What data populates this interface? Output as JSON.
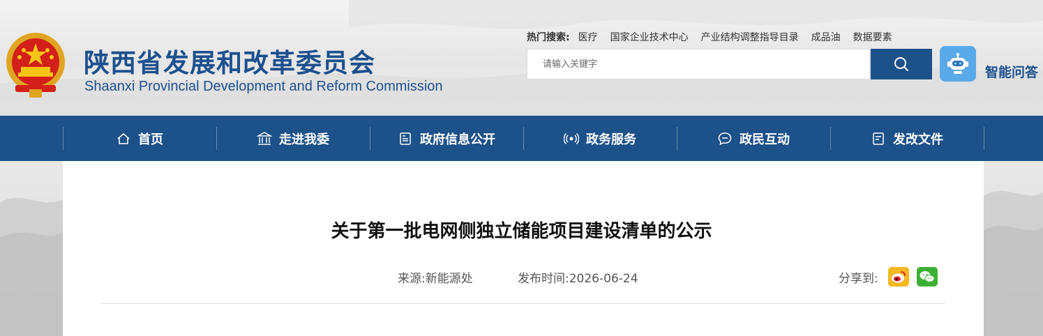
{
  "header": {
    "title_cn": "陕西省发展和改革委员会",
    "title_en": "Shaanxi Provincial Development and Reform Commission",
    "emblem_icon": "national-emblem-icon"
  },
  "hot_search": {
    "label": "热门搜索:",
    "items": [
      "医疗",
      "国家企业技术中心",
      "产业结构调整指导目录",
      "成品油",
      "数据要素"
    ]
  },
  "search": {
    "placeholder": "请输入关键字",
    "button_icon": "search-icon"
  },
  "ai_assistant": {
    "label": "智能问答",
    "icon": "robot-icon"
  },
  "nav": {
    "items": [
      {
        "label": "首页",
        "icon": "home-icon"
      },
      {
        "label": "走进我委",
        "icon": "building-icon"
      },
      {
        "label": "政府信息公开",
        "icon": "document-icon"
      },
      {
        "label": "政务服务",
        "icon": "service-icon"
      },
      {
        "label": "政民互动",
        "icon": "chat-icon"
      },
      {
        "label": "发改文件",
        "icon": "file-icon"
      }
    ]
  },
  "article": {
    "title": "关于第一批电网侧独立储能项目建设清单的公示",
    "source": "来源:新能源处",
    "publish_time": "发布时间:2026-06-24",
    "share_label": "分享到:",
    "share_icons": [
      "weibo-icon",
      "wechat-icon"
    ]
  },
  "colors": {
    "brand_blue": "#1c5189",
    "title_blue": "#1d508e",
    "ai_blue": "#5aa9e8",
    "weibo_bg": "#f5b820",
    "wechat_bg": "#3cb034"
  }
}
